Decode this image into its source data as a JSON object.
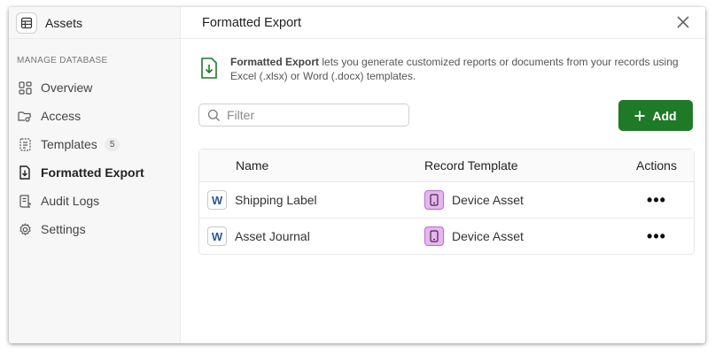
{
  "sidebar": {
    "title": "Assets",
    "section_label": "MANAGE DATABASE",
    "items": [
      {
        "label": "Overview",
        "icon": "grid-icon"
      },
      {
        "label": "Access",
        "icon": "folder-key-icon"
      },
      {
        "label": "Templates",
        "icon": "templates-icon",
        "badge": "5"
      },
      {
        "label": "Formatted Export",
        "icon": "file-download-icon",
        "active": true
      },
      {
        "label": "Audit Logs",
        "icon": "audit-log-icon"
      },
      {
        "label": "Settings",
        "icon": "gear-icon"
      }
    ]
  },
  "main": {
    "title": "Formatted Export",
    "info": {
      "bold": "Formatted Export",
      "text": " lets you generate customized reports or documents from your records using Excel (.xlsx) or Word (.docx) templates."
    },
    "filter": {
      "placeholder": "Filter",
      "value": ""
    },
    "add_label": "Add",
    "table": {
      "columns": [
        "Name",
        "Record Template",
        "Actions"
      ],
      "rows": [
        {
          "file_icon": "W",
          "name": "Shipping Label",
          "template": "Device Asset"
        },
        {
          "file_icon": "W",
          "name": "Asset Journal",
          "template": "Device Asset"
        }
      ]
    }
  },
  "colors": {
    "accent": "#1f7a27",
    "template_icon_bg": "#e8b4f2",
    "word_blue": "#2b579a"
  }
}
